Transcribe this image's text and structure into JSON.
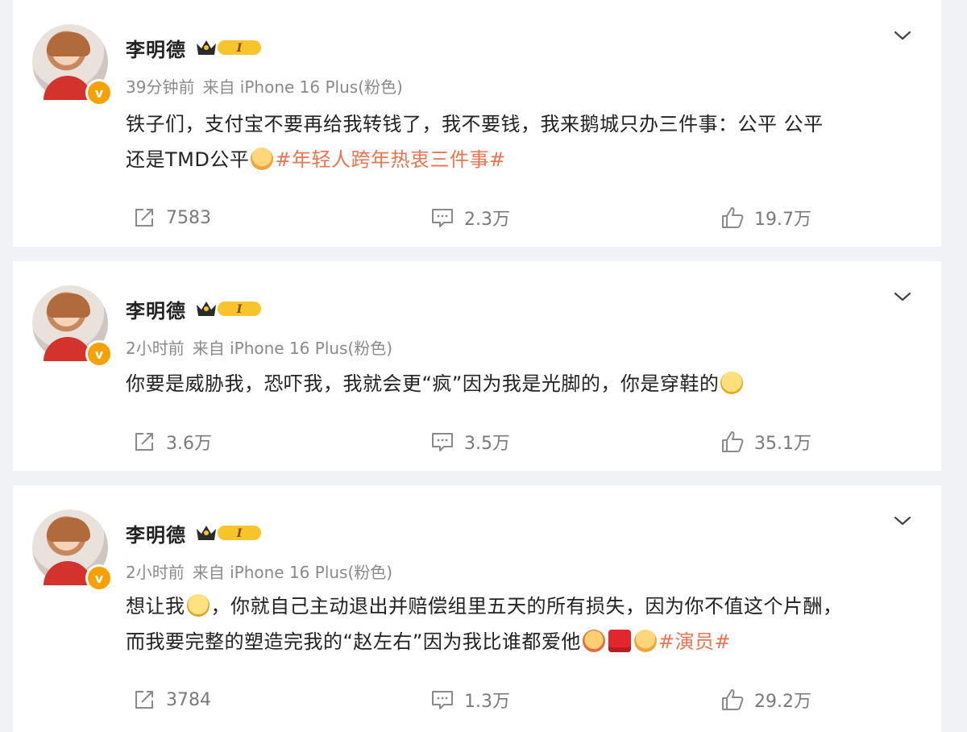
{
  "posts": [
    {
      "author": "李明德",
      "vip_level": "I",
      "verified_badge": "v",
      "time": "39分钟前",
      "source": "来自 iPhone 16 Plus(粉色)",
      "text_line1": "铁子们，支付宝不要再给我转钱了，我不要钱，我来鹅城只办三件事：公平 公平",
      "text_line2_before": "还是TMD公平",
      "emoji1": "hug-face-emoji",
      "hashtag": "#年轻人跨年热衷三件事#",
      "reposts": "7583",
      "comments": "2.3万",
      "likes": "19.7万"
    },
    {
      "author": "李明德",
      "vip_level": "I",
      "verified_badge": "v",
      "time": "2小时前",
      "source": "来自 iPhone 16 Plus(粉色)",
      "text_line1": "你要是威胁我，恐吓我，我就会更“疯”因为我是光脚的，你是穿鞋的",
      "emoji1": "grin-emoji",
      "reposts": "3.6万",
      "comments": "3.5万",
      "likes": "35.1万"
    },
    {
      "author": "李明德",
      "vip_level": "I",
      "verified_badge": "v",
      "time": "2小时前",
      "source": "来自 iPhone 16 Plus(粉色)",
      "text_line1_before": "想让我",
      "emoji1": "zipper-mouth-emoji",
      "text_line1_after": "，你就自己主动退出并赔偿组里五天的所有损失，因为你不值这个片酬，",
      "text_line2": "而我要完整的塑造完我的“赵左右”因为我比谁都爱他",
      "emoji2": "love-face-emoji",
      "emoji3": "gift-emoji",
      "emoji4": "hug-face-emoji",
      "hashtag": "#演员#",
      "reposts": "3784",
      "comments": "1.3万",
      "likes": "29.2万"
    }
  ],
  "colors": {
    "hashtag": "#eb7350",
    "meta": "#8a8a8a",
    "background": "#f1f2f5",
    "verified": "#f5a100"
  },
  "icons": {
    "share": "share-icon",
    "comment": "comment-icon",
    "like": "thumbs-up-icon",
    "menu": "chevron-down-icon"
  }
}
